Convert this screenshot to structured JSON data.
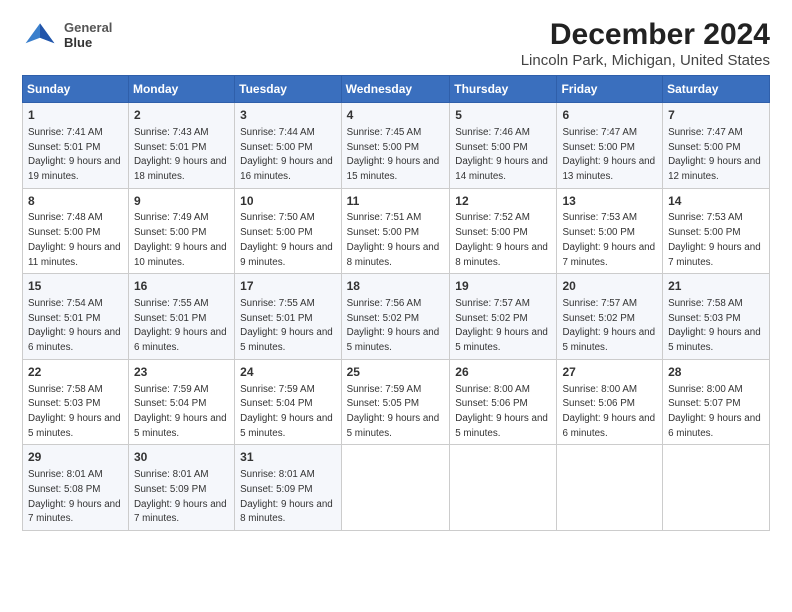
{
  "app": {
    "logo_line1": "General",
    "logo_line2": "Blue"
  },
  "header": {
    "month_year": "December 2024",
    "location": "Lincoln Park, Michigan, United States"
  },
  "weekdays": [
    "Sunday",
    "Monday",
    "Tuesday",
    "Wednesday",
    "Thursday",
    "Friday",
    "Saturday"
  ],
  "weeks": [
    [
      {
        "day": "1",
        "info": "Sunrise: 7:41 AM\nSunset: 5:01 PM\nDaylight: 9 hours and 19 minutes."
      },
      {
        "day": "2",
        "info": "Sunrise: 7:43 AM\nSunset: 5:01 PM\nDaylight: 9 hours and 18 minutes."
      },
      {
        "day": "3",
        "info": "Sunrise: 7:44 AM\nSunset: 5:00 PM\nDaylight: 9 hours and 16 minutes."
      },
      {
        "day": "4",
        "info": "Sunrise: 7:45 AM\nSunset: 5:00 PM\nDaylight: 9 hours and 15 minutes."
      },
      {
        "day": "5",
        "info": "Sunrise: 7:46 AM\nSunset: 5:00 PM\nDaylight: 9 hours and 14 minutes."
      },
      {
        "day": "6",
        "info": "Sunrise: 7:47 AM\nSunset: 5:00 PM\nDaylight: 9 hours and 13 minutes."
      },
      {
        "day": "7",
        "info": "Sunrise: 7:47 AM\nSunset: 5:00 PM\nDaylight: 9 hours and 12 minutes."
      }
    ],
    [
      {
        "day": "8",
        "info": "Sunrise: 7:48 AM\nSunset: 5:00 PM\nDaylight: 9 hours and 11 minutes."
      },
      {
        "day": "9",
        "info": "Sunrise: 7:49 AM\nSunset: 5:00 PM\nDaylight: 9 hours and 10 minutes."
      },
      {
        "day": "10",
        "info": "Sunrise: 7:50 AM\nSunset: 5:00 PM\nDaylight: 9 hours and 9 minutes."
      },
      {
        "day": "11",
        "info": "Sunrise: 7:51 AM\nSunset: 5:00 PM\nDaylight: 9 hours and 8 minutes."
      },
      {
        "day": "12",
        "info": "Sunrise: 7:52 AM\nSunset: 5:00 PM\nDaylight: 9 hours and 8 minutes."
      },
      {
        "day": "13",
        "info": "Sunrise: 7:53 AM\nSunset: 5:00 PM\nDaylight: 9 hours and 7 minutes."
      },
      {
        "day": "14",
        "info": "Sunrise: 7:53 AM\nSunset: 5:00 PM\nDaylight: 9 hours and 7 minutes."
      }
    ],
    [
      {
        "day": "15",
        "info": "Sunrise: 7:54 AM\nSunset: 5:01 PM\nDaylight: 9 hours and 6 minutes."
      },
      {
        "day": "16",
        "info": "Sunrise: 7:55 AM\nSunset: 5:01 PM\nDaylight: 9 hours and 6 minutes."
      },
      {
        "day": "17",
        "info": "Sunrise: 7:55 AM\nSunset: 5:01 PM\nDaylight: 9 hours and 5 minutes."
      },
      {
        "day": "18",
        "info": "Sunrise: 7:56 AM\nSunset: 5:02 PM\nDaylight: 9 hours and 5 minutes."
      },
      {
        "day": "19",
        "info": "Sunrise: 7:57 AM\nSunset: 5:02 PM\nDaylight: 9 hours and 5 minutes."
      },
      {
        "day": "20",
        "info": "Sunrise: 7:57 AM\nSunset: 5:02 PM\nDaylight: 9 hours and 5 minutes."
      },
      {
        "day": "21",
        "info": "Sunrise: 7:58 AM\nSunset: 5:03 PM\nDaylight: 9 hours and 5 minutes."
      }
    ],
    [
      {
        "day": "22",
        "info": "Sunrise: 7:58 AM\nSunset: 5:03 PM\nDaylight: 9 hours and 5 minutes."
      },
      {
        "day": "23",
        "info": "Sunrise: 7:59 AM\nSunset: 5:04 PM\nDaylight: 9 hours and 5 minutes."
      },
      {
        "day": "24",
        "info": "Sunrise: 7:59 AM\nSunset: 5:04 PM\nDaylight: 9 hours and 5 minutes."
      },
      {
        "day": "25",
        "info": "Sunrise: 7:59 AM\nSunset: 5:05 PM\nDaylight: 9 hours and 5 minutes."
      },
      {
        "day": "26",
        "info": "Sunrise: 8:00 AM\nSunset: 5:06 PM\nDaylight: 9 hours and 5 minutes."
      },
      {
        "day": "27",
        "info": "Sunrise: 8:00 AM\nSunset: 5:06 PM\nDaylight: 9 hours and 6 minutes."
      },
      {
        "day": "28",
        "info": "Sunrise: 8:00 AM\nSunset: 5:07 PM\nDaylight: 9 hours and 6 minutes."
      }
    ],
    [
      {
        "day": "29",
        "info": "Sunrise: 8:01 AM\nSunset: 5:08 PM\nDaylight: 9 hours and 7 minutes."
      },
      {
        "day": "30",
        "info": "Sunrise: 8:01 AM\nSunset: 5:09 PM\nDaylight: 9 hours and 7 minutes."
      },
      {
        "day": "31",
        "info": "Sunrise: 8:01 AM\nSunset: 5:09 PM\nDaylight: 9 hours and 8 minutes."
      },
      null,
      null,
      null,
      null
    ]
  ]
}
